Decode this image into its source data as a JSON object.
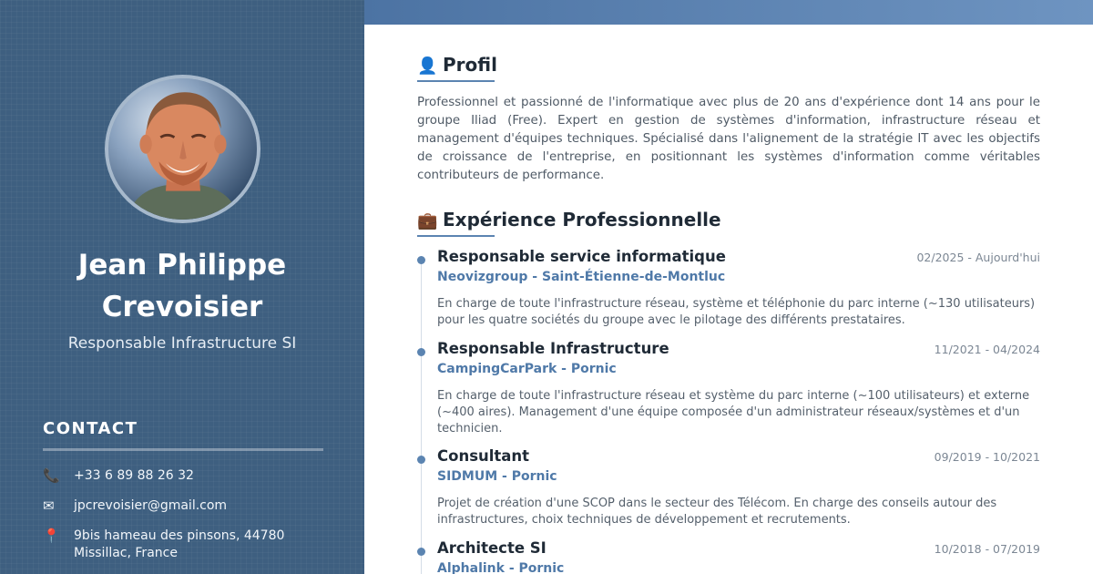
{
  "sidebar": {
    "name_line1": "Jean Philippe",
    "name_line2": "Crevoisier",
    "role": "Responsable Infrastructure SI",
    "contact_title": "CONTACT",
    "contacts": [
      {
        "icon": "phone-icon",
        "glyph": "📞",
        "text": "+33 6 89 88 26 32"
      },
      {
        "icon": "email-icon",
        "glyph": "✉",
        "text": "jpcrevoisier@gmail.com"
      },
      {
        "icon": "location-pin-icon",
        "glyph": "📍",
        "text": "9bis hameau des pinsons, 44780 Missillac, France"
      }
    ]
  },
  "main": {
    "profile": {
      "icon": "person-icon",
      "glyph": "👤",
      "title": "Profil",
      "text": "Professionnel et passionné de l'informatique avec plus de 20 ans d'expérience dont 14 ans pour le groupe Iliad (Free). Expert en gestion de systèmes d'information, infrastructure réseau et management d'équipes techniques. Spécialisé dans l'alignement de la stratégie IT avec les objectifs de croissance de l'entreprise, en positionnant les systèmes d'information comme véritables contributeurs de performance."
    },
    "experience": {
      "icon": "briefcase-icon",
      "glyph": "💼",
      "title": "Expérience Professionnelle",
      "jobs": [
        {
          "title": "Responsable service informatique",
          "company": "Neovizgroup - Saint-Étienne-de-Montluc",
          "dates": "02/2025 - Aujourd'hui",
          "desc": "En charge de toute l'infrastructure réseau, système et téléphonie du parc interne (~130 utilisateurs) pour les quatre sociétés du groupe avec le pilotage des différents prestataires."
        },
        {
          "title": "Responsable Infrastructure",
          "company": "CampingCarPark - Pornic",
          "dates": "11/2021 - 04/2024",
          "desc": "En charge de toute l'infrastructure réseau et système du parc interne (~100 utilisateurs) et externe (~400 aires). Management d'une équipe composée d'un administrateur réseaux/systèmes et d'un technicien."
        },
        {
          "title": "Consultant",
          "company": "SIDMUM - Pornic",
          "dates": "09/2019 - 10/2021",
          "desc": "Projet de création d'une SCOP dans le secteur des Télécom. En charge des conseils autour des infrastructures, choix techniques de développement et recrutements."
        },
        {
          "title": "Architecte SI",
          "company": "Alphalink - Pornic",
          "dates": "10/2018 - 07/2019",
          "desc": ""
        }
      ]
    }
  },
  "colors": {
    "sidebar_bg": "#3e5f80",
    "accent": "#5b84b1",
    "company": "#4f79a8"
  }
}
